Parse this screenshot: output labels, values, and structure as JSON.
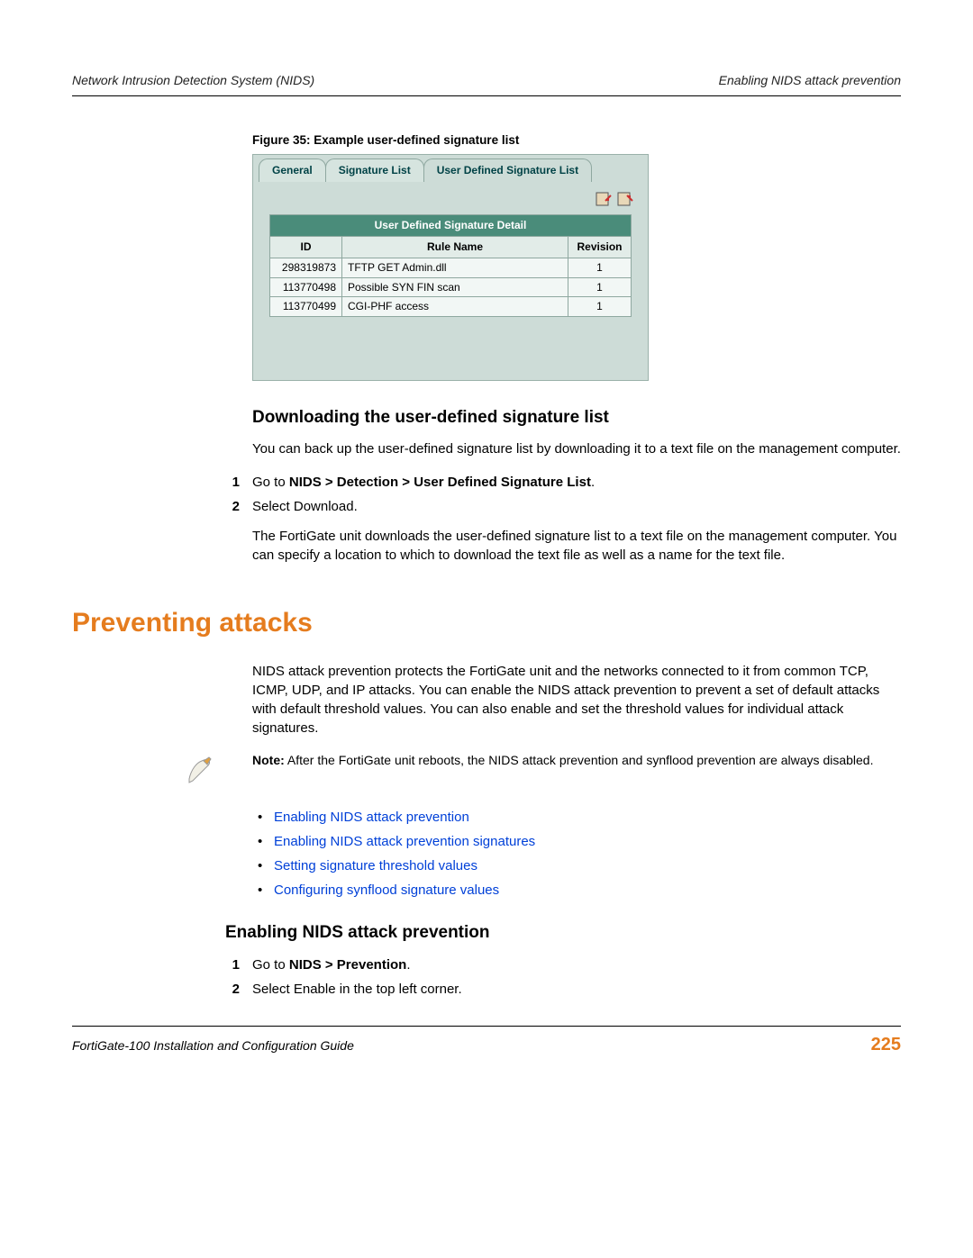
{
  "header": {
    "left": "Network Intrusion Detection System (NIDS)",
    "right": "Enabling NIDS attack prevention"
  },
  "figure": {
    "caption": "Figure 35: Example user-defined signature list",
    "tabs": [
      "General",
      "Signature List",
      "User Defined Signature List"
    ],
    "table_caption": "User Defined Signature Detail",
    "columns": [
      "ID",
      "Rule Name",
      "Revision"
    ],
    "rows": [
      {
        "id": "298319873",
        "rule": "TFTP GET Admin.dll",
        "rev": "1"
      },
      {
        "id": "113770498",
        "rule": "Possible SYN FIN scan",
        "rev": "1"
      },
      {
        "id": "113770499",
        "rule": "CGI-PHF access",
        "rev": "1"
      }
    ]
  },
  "sec_download": {
    "title": "Downloading the user-defined signature list",
    "intro": "You can back up the user-defined signature list by downloading it to a text file on the management computer.",
    "step1_prefix": "Go to ",
    "step1_bold": "NIDS > Detection > User Defined Signature List",
    "step1_suffix": ".",
    "step2": "Select Download.",
    "result": "The FortiGate unit downloads the user-defined signature list to a text file on the management computer. You can specify a location to which to download the text file as well as a name for the text file."
  },
  "sec_prevent": {
    "title": "Preventing attacks",
    "intro": "NIDS attack prevention protects the FortiGate unit and the networks connected to it from common TCP, ICMP, UDP, and IP attacks. You can enable the NIDS attack prevention to prevent a set of default attacks with default threshold values. You can also enable and set the threshold values for individual attack signatures.",
    "note_label": "Note:",
    "note_text": " After the FortiGate unit reboots, the NIDS attack prevention and synflood prevention are always disabled.",
    "links": [
      "Enabling NIDS attack prevention",
      "Enabling NIDS attack prevention signatures",
      "Setting signature threshold values",
      "Configuring synflood signature values"
    ]
  },
  "sec_enable": {
    "title": "Enabling NIDS attack prevention",
    "step1_prefix": "Go to ",
    "step1_bold": "NIDS > Prevention",
    "step1_suffix": ".",
    "step2": "Select Enable in the top left corner."
  },
  "footer": {
    "left": "FortiGate-100 Installation and Configuration Guide",
    "page": "225"
  },
  "nums": {
    "n1": "1",
    "n2": "2"
  }
}
